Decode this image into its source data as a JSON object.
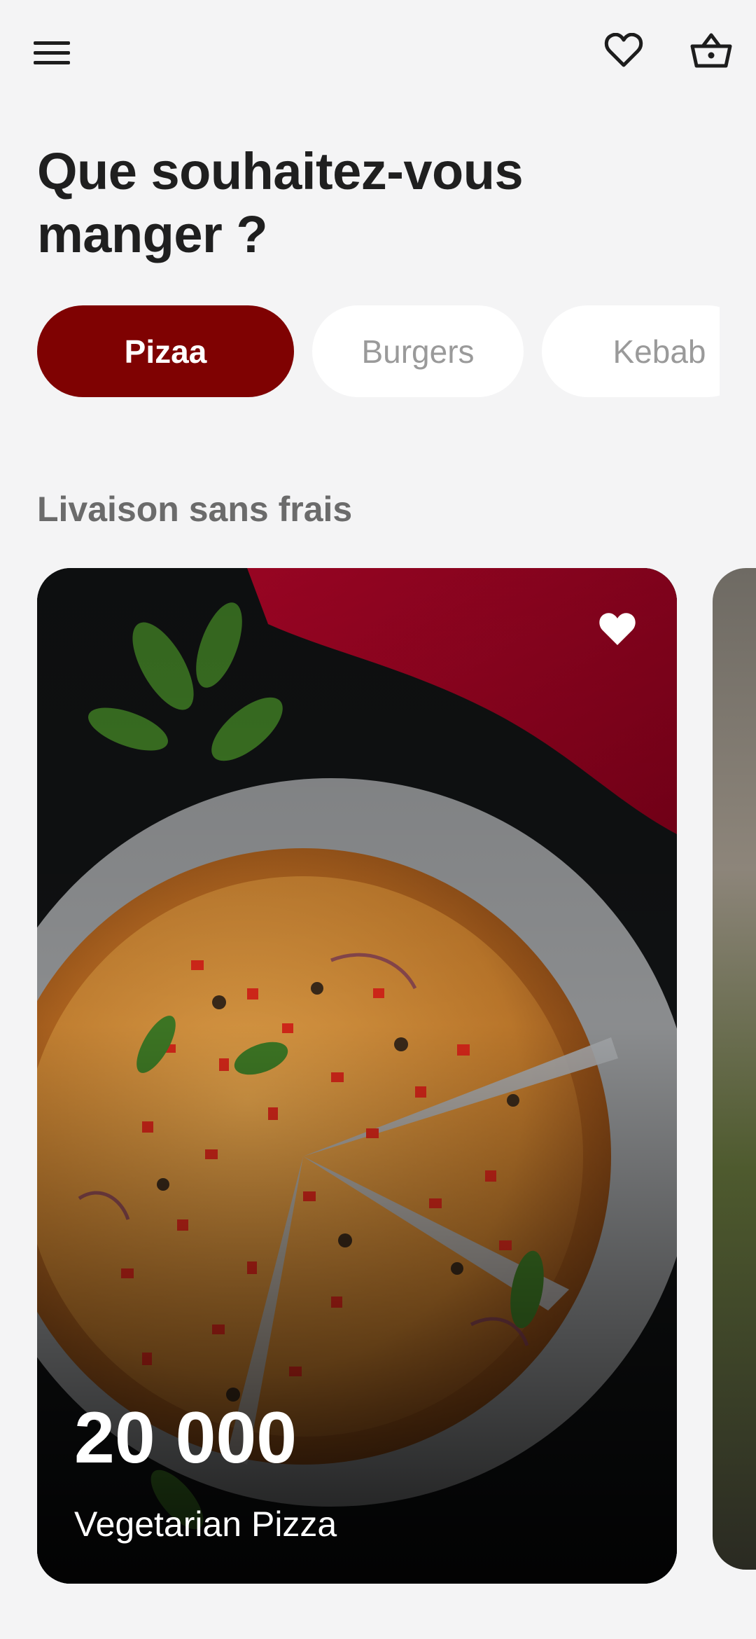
{
  "header": {
    "title": "Que souhaitez-vous manger ?",
    "icons": {
      "menu": "hamburger-menu-icon",
      "favorites": "heart-outline-icon",
      "cart": "shopping-basket-icon"
    }
  },
  "categories": [
    {
      "label": "Pizaa",
      "active": true
    },
    {
      "label": "Burgers",
      "active": false
    },
    {
      "label": "Kebab",
      "active": false
    }
  ],
  "section": {
    "title": "Livaison sans frais"
  },
  "cards": [
    {
      "price": "20 000",
      "name": "Vegetarian Pizza",
      "favorite": true
    }
  ],
  "colors": {
    "background": "#f4f4f5",
    "accent": "#7f0202",
    "pill_inactive_bg": "#ffffff",
    "pill_inactive_text": "#9a9a9a",
    "heading": "#1f1f1f",
    "section_heading": "#6b6b6b"
  }
}
